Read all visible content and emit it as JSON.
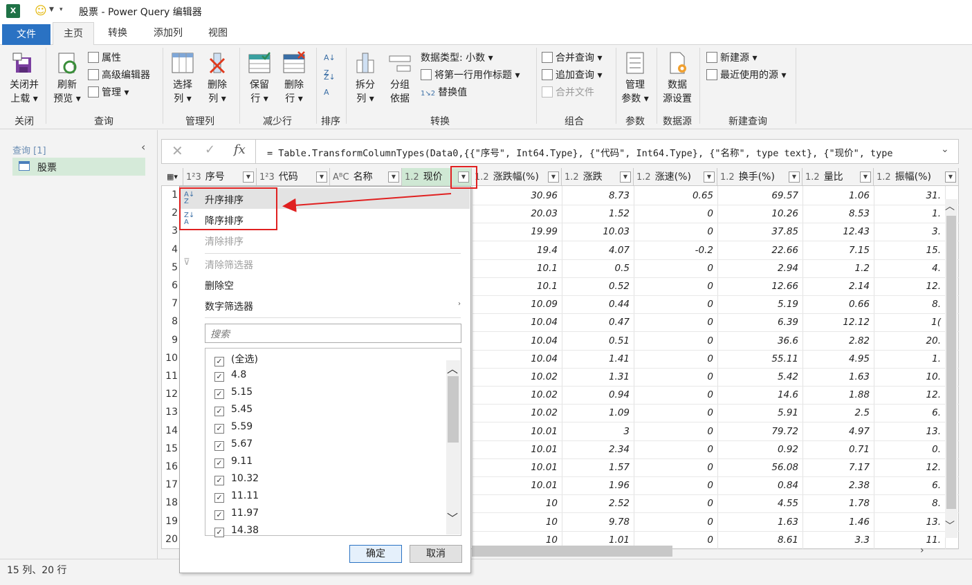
{
  "titlebar": {
    "title": "股票 - Power Query 编辑器",
    "app_icon": "X"
  },
  "tabs": [
    "文件",
    "主页",
    "转换",
    "添加列",
    "视图"
  ],
  "ribbon": {
    "close": {
      "btn": [
        "关闭并",
        "上载 ▾"
      ],
      "group": "关闭"
    },
    "query": {
      "refresh": [
        "刷新",
        "预览 ▾"
      ],
      "props": "属性",
      "adv": "高级编辑器",
      "manage": "管理 ▾",
      "group": "查询"
    },
    "manage_cols": {
      "select": [
        "选择",
        "列 ▾"
      ],
      "remove": [
        "删除",
        "列 ▾"
      ],
      "group": "管理列"
    },
    "reduce_rows": {
      "keep": [
        "保留",
        "行 ▾"
      ],
      "remove": [
        "删除",
        "行 ▾"
      ],
      "group": "减少行"
    },
    "sort": {
      "group": "排序"
    },
    "transform": {
      "split": [
        "拆分",
        "列 ▾"
      ],
      "groupby": [
        "分组",
        "依据"
      ],
      "datatype": "数据类型: 小数 ▾",
      "firstrow": "将第一行用作标题 ▾",
      "replace": "替换值",
      "group": "转换"
    },
    "combine": {
      "merge": "合并查询 ▾",
      "append": "追加查询 ▾",
      "files": "合并文件",
      "group": "组合"
    },
    "params": {
      "btn": [
        "管理",
        "参数 ▾"
      ],
      "group": "参数"
    },
    "datasource": {
      "btn": [
        "数据",
        "源设置"
      ],
      "group": "数据源"
    },
    "newquery": {
      "newsrc": "新建源 ▾",
      "recent": "最近使用的源 ▾",
      "group": "新建查询"
    }
  },
  "queries": {
    "header": "查询 [1]",
    "items": [
      "股票"
    ]
  },
  "formula": "= Table.TransformColumnTypes(Data0,{{\"序号\", Int64.Type}, {\"代码\", Int64.Type}, {\"名称\", type text}, {\"现价\", type",
  "columns": [
    {
      "type": "1²3",
      "name": "序号"
    },
    {
      "type": "1²3",
      "name": "代码"
    },
    {
      "type": "AᴮC",
      "name": "名称"
    },
    {
      "type": "1.2",
      "name": "现价"
    },
    {
      "type": "1.2",
      "name": "涨跌幅(%)"
    },
    {
      "type": "1.2",
      "name": "涨跌"
    },
    {
      "type": "1.2",
      "name": "涨速(%)"
    },
    {
      "type": "1.2",
      "name": "换手(%)"
    },
    {
      "type": "1.2",
      "name": "量比"
    },
    {
      "type": "1.2",
      "name": "振幅(%)"
    }
  ],
  "row_numbers": [
    "1",
    "2",
    "3",
    "4",
    "5",
    "6",
    "7",
    "8",
    "9",
    "10",
    "11",
    "12",
    "13",
    "14",
    "15",
    "16",
    "17",
    "18",
    "19",
    "20"
  ],
  "rows": [
    [
      "30.96",
      "8.73",
      "0.65",
      "69.57",
      "1.06",
      "31."
    ],
    [
      "20.03",
      "1.52",
      "0",
      "10.26",
      "8.53",
      "1."
    ],
    [
      "19.99",
      "10.03",
      "0",
      "37.85",
      "12.43",
      "3."
    ],
    [
      "19.4",
      "4.07",
      "-0.2",
      "22.66",
      "7.15",
      "15."
    ],
    [
      "10.1",
      "0.5",
      "0",
      "2.94",
      "1.2",
      "4."
    ],
    [
      "10.1",
      "0.52",
      "0",
      "12.66",
      "2.14",
      "12."
    ],
    [
      "10.09",
      "0.44",
      "0",
      "5.19",
      "0.66",
      "8."
    ],
    [
      "10.04",
      "0.47",
      "0",
      "6.39",
      "12.12",
      "1("
    ],
    [
      "10.04",
      "0.51",
      "0",
      "36.6",
      "2.82",
      "20."
    ],
    [
      "10.04",
      "1.41",
      "0",
      "55.11",
      "4.95",
      "1."
    ],
    [
      "10.02",
      "1.31",
      "0",
      "5.42",
      "1.63",
      "10."
    ],
    [
      "10.02",
      "0.94",
      "0",
      "14.6",
      "1.88",
      "12."
    ],
    [
      "10.02",
      "1.09",
      "0",
      "5.91",
      "2.5",
      "6."
    ],
    [
      "10.01",
      "3",
      "0",
      "79.72",
      "4.97",
      "13."
    ],
    [
      "10.01",
      "2.34",
      "0",
      "0.92",
      "0.71",
      "0."
    ],
    [
      "10.01",
      "1.57",
      "0",
      "56.08",
      "7.17",
      "12."
    ],
    [
      "10.01",
      "1.96",
      "0",
      "0.84",
      "2.38",
      "6."
    ],
    [
      "10",
      "2.52",
      "0",
      "4.55",
      "1.78",
      "8."
    ],
    [
      "10",
      "9.78",
      "0",
      "1.63",
      "1.46",
      "13."
    ],
    [
      "10",
      "1.01",
      "0",
      "8.61",
      "3.3",
      "11."
    ]
  ],
  "menu": {
    "asc": "升序排序",
    "desc": "降序排序",
    "clear_sort": "清除排序",
    "clear_filter": "清除筛选器",
    "remove_empty": "删除空",
    "number_filters": "数字筛选器",
    "search_placeholder": "搜索",
    "values": [
      "(全选)",
      "4.8",
      "5.15",
      "5.45",
      "5.59",
      "5.67",
      "9.11",
      "10.32",
      "11.11",
      "11.97",
      "14.38"
    ],
    "ok": "确定",
    "cancel": "取消"
  },
  "status": "15 列、20 行",
  "colors": {
    "file_tab": "#2a72c3",
    "annotation": "#e02020",
    "query_selected": "#d5ead9"
  }
}
